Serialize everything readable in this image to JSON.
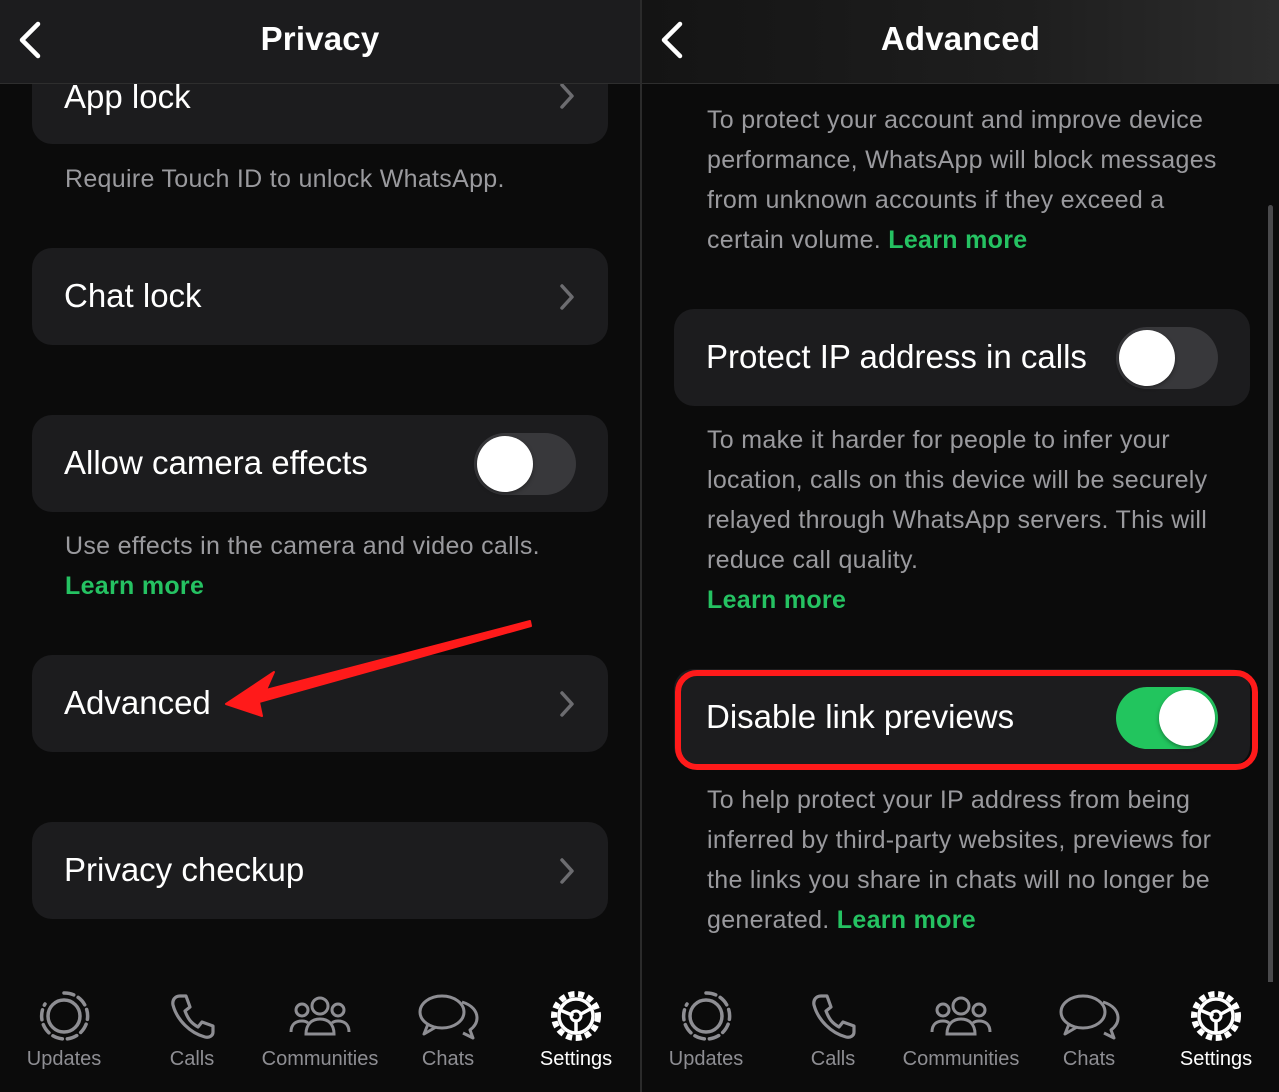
{
  "left": {
    "title": "Privacy",
    "items": {
      "app_lock": {
        "label": "App lock",
        "desc": "Require Touch ID to unlock WhatsApp."
      },
      "chat_lock": {
        "label": "Chat lock"
      },
      "camera_effects": {
        "label": "Allow camera effects",
        "toggle_on": false,
        "desc": "Use effects in the camera and video calls.",
        "link": "Learn more"
      },
      "advanced": {
        "label": "Advanced"
      },
      "privacy_checkup": {
        "label": "Privacy checkup"
      }
    },
    "annotation": {
      "type": "arrow",
      "color": "#ff1a1a",
      "points_to": "Advanced"
    }
  },
  "right": {
    "title": "Advanced",
    "intro": {
      "text": "To protect your account and improve device performance, WhatsApp will block messages from unknown accounts if they exceed a certain volume.",
      "link": "Learn more"
    },
    "protect_ip": {
      "label": "Protect IP address in calls",
      "toggle_on": false,
      "desc": "To make it harder for people to infer your location, calls on this device will be securely relayed through WhatsApp servers. This will reduce call quality.",
      "link": "Learn more"
    },
    "link_previews": {
      "label": "Disable link previews",
      "toggle_on": true,
      "highlighted": true,
      "desc": "To help protect your IP address from being inferred by third-party websites, previews for the links you share in chats will no longer be generated.",
      "link": "Learn more"
    }
  },
  "tabs": [
    {
      "label": "Updates",
      "icon": "updates-icon"
    },
    {
      "label": "Calls",
      "icon": "phone-icon"
    },
    {
      "label": "Communities",
      "icon": "communities-icon"
    },
    {
      "label": "Chats",
      "icon": "chats-icon"
    },
    {
      "label": "Settings",
      "icon": "gear-icon",
      "active": true
    }
  ],
  "colors": {
    "accent_green": "#25c262",
    "toggle_on": "#22c55e",
    "annotation_red": "#ff1a1a",
    "card_bg": "#1c1c1e",
    "text_secondary": "#9a9a9e"
  }
}
